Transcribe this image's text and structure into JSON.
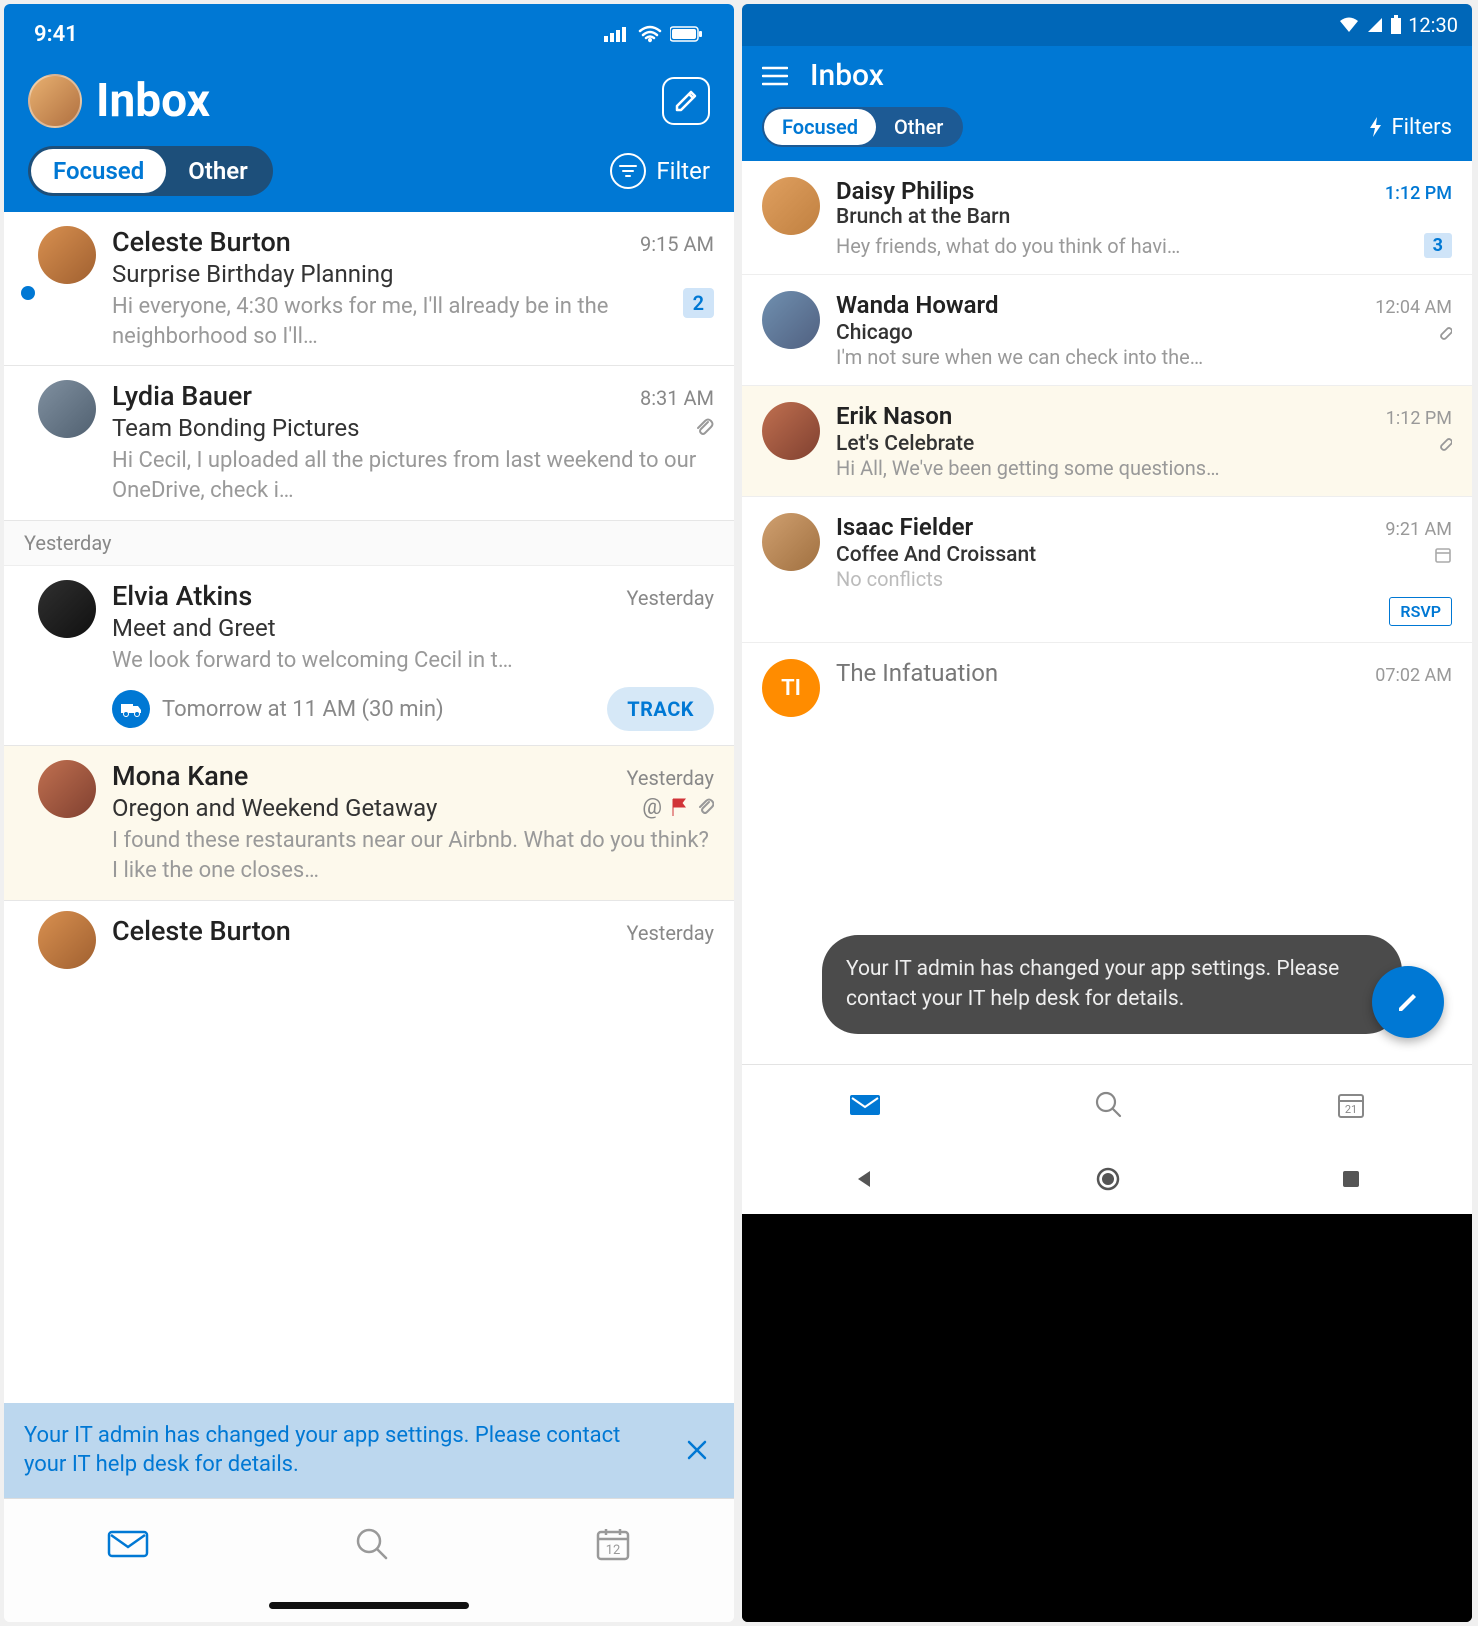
{
  "ios": {
    "status_time": "9:41",
    "title": "Inbox",
    "tabs": {
      "focused": "Focused",
      "other": "Other"
    },
    "filter_label": "Filter",
    "section_yesterday": "Yesterday",
    "banner": "Your IT admin has changed your app settings. Please contact your IT help desk for details.",
    "calendar_day": "12",
    "messages": [
      {
        "sender": "Celeste Burton",
        "time": "9:15 AM",
        "subject": "Surprise Birthday Planning",
        "preview": "Hi everyone, 4:30 works for me, I'll already be in the neighborhood so I'll…",
        "count": "2"
      },
      {
        "sender": "Lydia Bauer",
        "time": "8:31 AM",
        "subject": "Team Bonding Pictures",
        "preview": "Hi Cecil, I uploaded all the pictures from last weekend to our OneDrive, check i…"
      },
      {
        "sender": "Elvia Atkins",
        "time": "Yesterday",
        "subject": "Meet and Greet",
        "preview": "We look forward to welcoming Cecil in t…",
        "event_text": "Tomorrow at 11 AM (30 min)",
        "track": "TRACK"
      },
      {
        "sender": "Mona Kane",
        "time": "Yesterday",
        "subject": "Oregon and Weekend Getaway",
        "preview": "I found these restaurants near our Airbnb. What do you think? I like the one closes…"
      },
      {
        "sender": "Celeste Burton",
        "time": "Yesterday"
      }
    ]
  },
  "android": {
    "status_time": "12:30",
    "title": "Inbox",
    "tabs": {
      "focused": "Focused",
      "other": "Other"
    },
    "filters_label": "Filters",
    "toast": "Your IT admin has changed your app settings. Please contact your IT help desk for details.",
    "calendar_day": "21",
    "rsvp": "RSVP",
    "messages": [
      {
        "sender": "Daisy Philips",
        "time": "1:12 PM",
        "subject": "Brunch at the Barn",
        "preview": "Hey friends, what do you think of havi…",
        "count": "3"
      },
      {
        "sender": "Wanda Howard",
        "time": "12:04 AM",
        "subject": "Chicago",
        "preview": "I'm not sure when we can check into the…"
      },
      {
        "sender": "Erik Nason",
        "time": "1:12 PM",
        "subject": "Let's Celebrate",
        "preview": "Hi All, We've been getting some questions…"
      },
      {
        "sender": "Isaac Fielder",
        "time": "9:21 AM",
        "subject": "Coffee And Croissant",
        "preview": "No conflicts"
      },
      {
        "sender": "The Infatuation",
        "time": "07:02 AM",
        "initials": "TI"
      }
    ]
  }
}
